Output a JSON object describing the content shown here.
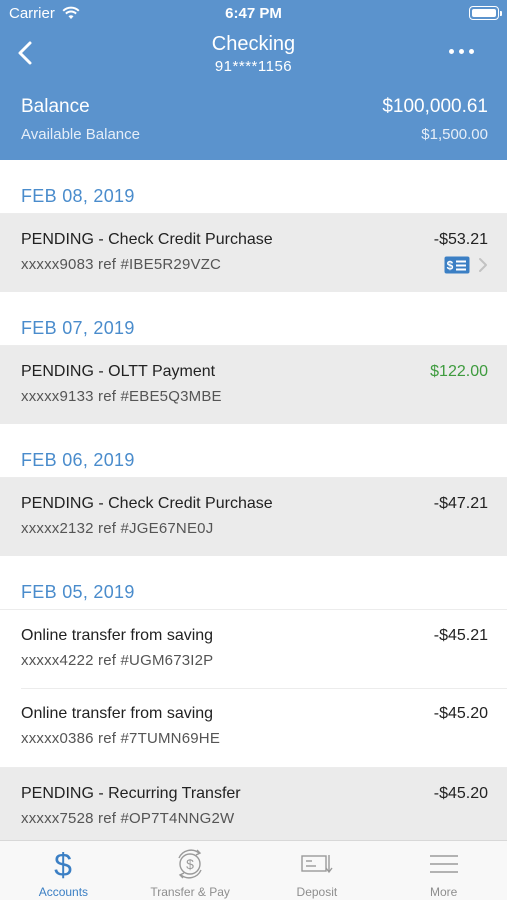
{
  "status": {
    "carrier": "Carrier",
    "time": "6:47 PM"
  },
  "nav": {
    "title": "Checking",
    "account": "91****1156"
  },
  "balance": {
    "label": "Balance",
    "value": "$100,000.61",
    "available_label": "Available Balance",
    "available_value": "$1,500.00"
  },
  "groups": [
    {
      "date": "FEB 08, 2019",
      "items": [
        {
          "title": "PENDING - Check Credit Purchase",
          "ref": "xxxxx9083 ref #IBE5R29VZC",
          "amount": "-$53.21"
        }
      ]
    },
    {
      "date": "FEB 07, 2019",
      "items": [
        {
          "title": "PENDING - OLTT Payment",
          "ref": "xxxxx9133 ref #EBE5Q3MBE",
          "amount": "$122.00"
        }
      ]
    },
    {
      "date": "FEB 06, 2019",
      "items": [
        {
          "title": "PENDING - Check Credit Purchase",
          "ref": "xxxxx2132 ref #JGE67NE0J",
          "amount": "-$47.21"
        }
      ]
    },
    {
      "date": "FEB 05, 2019",
      "items": [
        {
          "title": "Online transfer from saving",
          "ref": "xxxxx4222 ref #UGM673I2P",
          "amount": "-$45.21"
        },
        {
          "title": "Online transfer from saving",
          "ref": "xxxxx0386 ref #7TUMN69HE",
          "amount": "-$45.20"
        },
        {
          "title": "PENDING - Recurring Transfer",
          "ref": "xxxxx7528 ref #OP7T4NNG2W",
          "amount": "-$45.20"
        }
      ]
    }
  ],
  "tabs": [
    {
      "label": "Accounts",
      "icon": "dollar-icon"
    },
    {
      "label": "Transfer & Pay",
      "icon": "transfer-icon"
    },
    {
      "label": "Deposit",
      "icon": "deposit-check-icon"
    },
    {
      "label": "More",
      "icon": "menu-icon"
    }
  ],
  "colors": {
    "header": "#5b93cd",
    "date_header": "#4a8ccc",
    "positive": "#3e9b3e",
    "active_tab": "#3b7fc4"
  }
}
